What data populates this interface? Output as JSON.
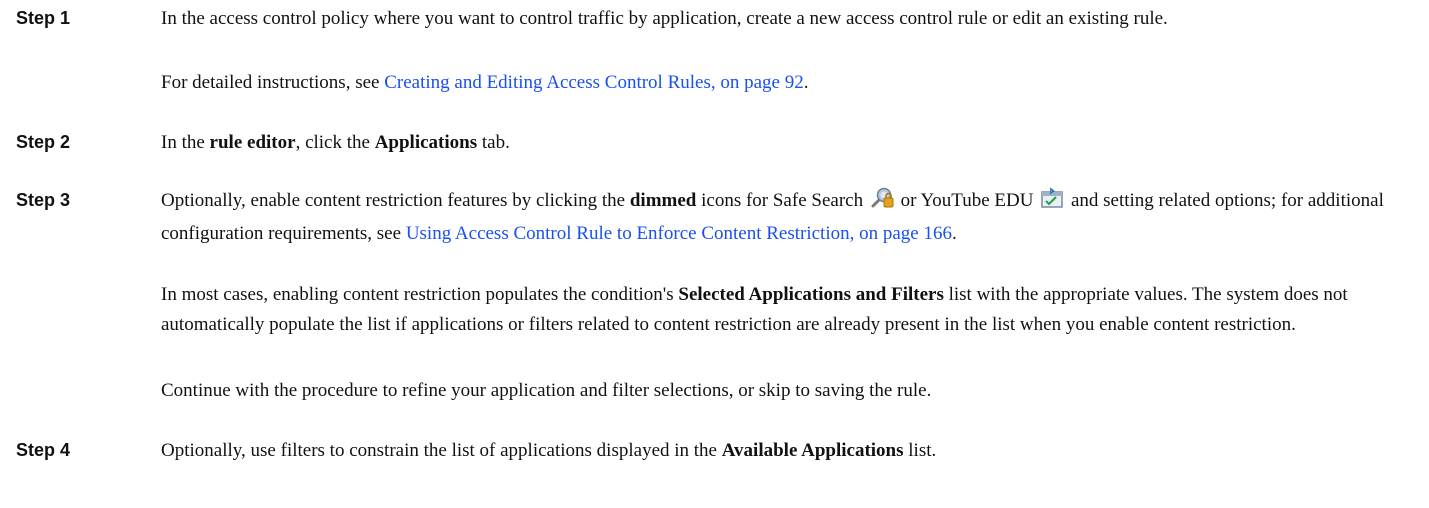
{
  "steps": [
    {
      "label": "Step 1",
      "p1_text": "In the access control policy where you want to control traffic by application, create a new access control rule or edit an existing rule.",
      "p2_pre": "For detailed instructions, see ",
      "p2_link": "Creating and Editing Access Control Rules, on page 92",
      "p2_post": "."
    },
    {
      "label": "Step 2",
      "t1": "In the ",
      "b1": "rule editor",
      "t2": ", click the ",
      "b2": "Applications",
      "t3": " tab."
    },
    {
      "label": "Step 3",
      "t1": "Optionally, enable content restriction features by clicking the ",
      "b1": "dimmed",
      "t2": " icons for Safe Search ",
      "t3": " or YouTube EDU ",
      "t4": " and setting related options; for additional configuration requirements, see ",
      "link": "Using Access Control Rule to Enforce Content Restriction, on page 166",
      "t5": ".",
      "p2_t1": "In most cases, enabling content restriction populates the condition's ",
      "p2_b1": "Selected Applications and Filters",
      "p2_t2": " list with the appropriate values. The system does not automatically populate the list if applications or filters related to content restriction are already present in the list when you enable content restriction.",
      "p3": "Continue with the procedure to refine your application and filter selections, or skip to saving the rule."
    },
    {
      "label": "Step 4",
      "t1": "Optionally, use filters to constrain the list of applications displayed in the ",
      "b1": "Available Applications",
      "t2": " list."
    }
  ],
  "icons": [
    "safe-search-icon",
    "youtube-edu-icon"
  ],
  "colors": {
    "link": "#1a4ff0",
    "text": "#111111"
  }
}
